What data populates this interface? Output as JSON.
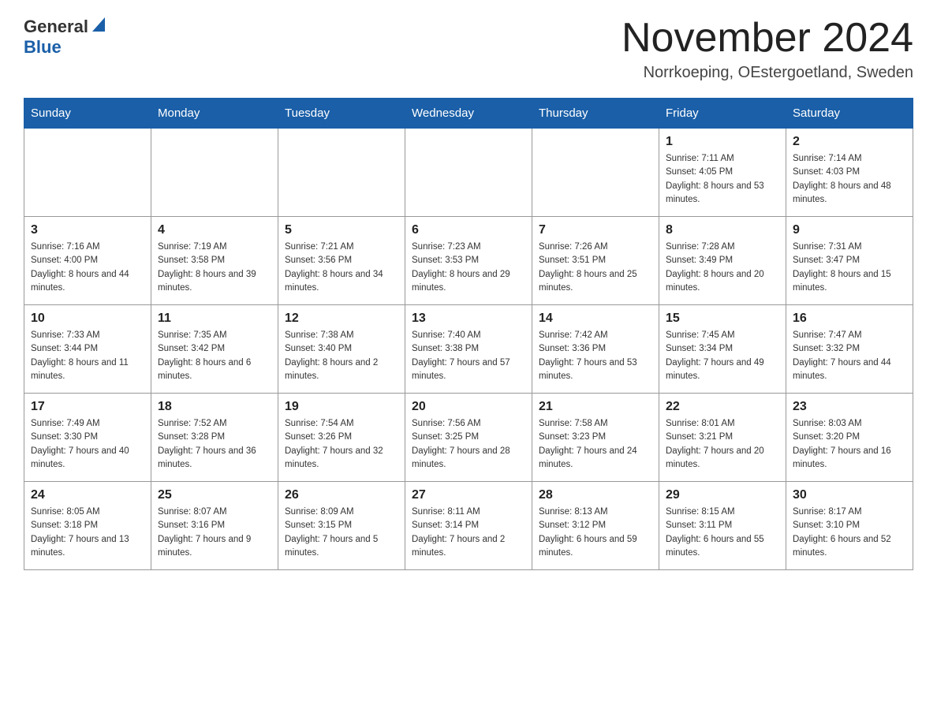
{
  "header": {
    "logo_general": "General",
    "logo_blue": "Blue",
    "month_title": "November 2024",
    "location": "Norrkoeping, OEstergoetland, Sweden"
  },
  "days_of_week": [
    "Sunday",
    "Monday",
    "Tuesday",
    "Wednesday",
    "Thursday",
    "Friday",
    "Saturday"
  ],
  "weeks": [
    [
      {
        "day": "",
        "sunrise": "",
        "sunset": "",
        "daylight": ""
      },
      {
        "day": "",
        "sunrise": "",
        "sunset": "",
        "daylight": ""
      },
      {
        "day": "",
        "sunrise": "",
        "sunset": "",
        "daylight": ""
      },
      {
        "day": "",
        "sunrise": "",
        "sunset": "",
        "daylight": ""
      },
      {
        "day": "",
        "sunrise": "",
        "sunset": "",
        "daylight": ""
      },
      {
        "day": "1",
        "sunrise": "Sunrise: 7:11 AM",
        "sunset": "Sunset: 4:05 PM",
        "daylight": "Daylight: 8 hours and 53 minutes."
      },
      {
        "day": "2",
        "sunrise": "Sunrise: 7:14 AM",
        "sunset": "Sunset: 4:03 PM",
        "daylight": "Daylight: 8 hours and 48 minutes."
      }
    ],
    [
      {
        "day": "3",
        "sunrise": "Sunrise: 7:16 AM",
        "sunset": "Sunset: 4:00 PM",
        "daylight": "Daylight: 8 hours and 44 minutes."
      },
      {
        "day": "4",
        "sunrise": "Sunrise: 7:19 AM",
        "sunset": "Sunset: 3:58 PM",
        "daylight": "Daylight: 8 hours and 39 minutes."
      },
      {
        "day": "5",
        "sunrise": "Sunrise: 7:21 AM",
        "sunset": "Sunset: 3:56 PM",
        "daylight": "Daylight: 8 hours and 34 minutes."
      },
      {
        "day": "6",
        "sunrise": "Sunrise: 7:23 AM",
        "sunset": "Sunset: 3:53 PM",
        "daylight": "Daylight: 8 hours and 29 minutes."
      },
      {
        "day": "7",
        "sunrise": "Sunrise: 7:26 AM",
        "sunset": "Sunset: 3:51 PM",
        "daylight": "Daylight: 8 hours and 25 minutes."
      },
      {
        "day": "8",
        "sunrise": "Sunrise: 7:28 AM",
        "sunset": "Sunset: 3:49 PM",
        "daylight": "Daylight: 8 hours and 20 minutes."
      },
      {
        "day": "9",
        "sunrise": "Sunrise: 7:31 AM",
        "sunset": "Sunset: 3:47 PM",
        "daylight": "Daylight: 8 hours and 15 minutes."
      }
    ],
    [
      {
        "day": "10",
        "sunrise": "Sunrise: 7:33 AM",
        "sunset": "Sunset: 3:44 PM",
        "daylight": "Daylight: 8 hours and 11 minutes."
      },
      {
        "day": "11",
        "sunrise": "Sunrise: 7:35 AM",
        "sunset": "Sunset: 3:42 PM",
        "daylight": "Daylight: 8 hours and 6 minutes."
      },
      {
        "day": "12",
        "sunrise": "Sunrise: 7:38 AM",
        "sunset": "Sunset: 3:40 PM",
        "daylight": "Daylight: 8 hours and 2 minutes."
      },
      {
        "day": "13",
        "sunrise": "Sunrise: 7:40 AM",
        "sunset": "Sunset: 3:38 PM",
        "daylight": "Daylight: 7 hours and 57 minutes."
      },
      {
        "day": "14",
        "sunrise": "Sunrise: 7:42 AM",
        "sunset": "Sunset: 3:36 PM",
        "daylight": "Daylight: 7 hours and 53 minutes."
      },
      {
        "day": "15",
        "sunrise": "Sunrise: 7:45 AM",
        "sunset": "Sunset: 3:34 PM",
        "daylight": "Daylight: 7 hours and 49 minutes."
      },
      {
        "day": "16",
        "sunrise": "Sunrise: 7:47 AM",
        "sunset": "Sunset: 3:32 PM",
        "daylight": "Daylight: 7 hours and 44 minutes."
      }
    ],
    [
      {
        "day": "17",
        "sunrise": "Sunrise: 7:49 AM",
        "sunset": "Sunset: 3:30 PM",
        "daylight": "Daylight: 7 hours and 40 minutes."
      },
      {
        "day": "18",
        "sunrise": "Sunrise: 7:52 AM",
        "sunset": "Sunset: 3:28 PM",
        "daylight": "Daylight: 7 hours and 36 minutes."
      },
      {
        "day": "19",
        "sunrise": "Sunrise: 7:54 AM",
        "sunset": "Sunset: 3:26 PM",
        "daylight": "Daylight: 7 hours and 32 minutes."
      },
      {
        "day": "20",
        "sunrise": "Sunrise: 7:56 AM",
        "sunset": "Sunset: 3:25 PM",
        "daylight": "Daylight: 7 hours and 28 minutes."
      },
      {
        "day": "21",
        "sunrise": "Sunrise: 7:58 AM",
        "sunset": "Sunset: 3:23 PM",
        "daylight": "Daylight: 7 hours and 24 minutes."
      },
      {
        "day": "22",
        "sunrise": "Sunrise: 8:01 AM",
        "sunset": "Sunset: 3:21 PM",
        "daylight": "Daylight: 7 hours and 20 minutes."
      },
      {
        "day": "23",
        "sunrise": "Sunrise: 8:03 AM",
        "sunset": "Sunset: 3:20 PM",
        "daylight": "Daylight: 7 hours and 16 minutes."
      }
    ],
    [
      {
        "day": "24",
        "sunrise": "Sunrise: 8:05 AM",
        "sunset": "Sunset: 3:18 PM",
        "daylight": "Daylight: 7 hours and 13 minutes."
      },
      {
        "day": "25",
        "sunrise": "Sunrise: 8:07 AM",
        "sunset": "Sunset: 3:16 PM",
        "daylight": "Daylight: 7 hours and 9 minutes."
      },
      {
        "day": "26",
        "sunrise": "Sunrise: 8:09 AM",
        "sunset": "Sunset: 3:15 PM",
        "daylight": "Daylight: 7 hours and 5 minutes."
      },
      {
        "day": "27",
        "sunrise": "Sunrise: 8:11 AM",
        "sunset": "Sunset: 3:14 PM",
        "daylight": "Daylight: 7 hours and 2 minutes."
      },
      {
        "day": "28",
        "sunrise": "Sunrise: 8:13 AM",
        "sunset": "Sunset: 3:12 PM",
        "daylight": "Daylight: 6 hours and 59 minutes."
      },
      {
        "day": "29",
        "sunrise": "Sunrise: 8:15 AM",
        "sunset": "Sunset: 3:11 PM",
        "daylight": "Daylight: 6 hours and 55 minutes."
      },
      {
        "day": "30",
        "sunrise": "Sunrise: 8:17 AM",
        "sunset": "Sunset: 3:10 PM",
        "daylight": "Daylight: 6 hours and 52 minutes."
      }
    ]
  ]
}
